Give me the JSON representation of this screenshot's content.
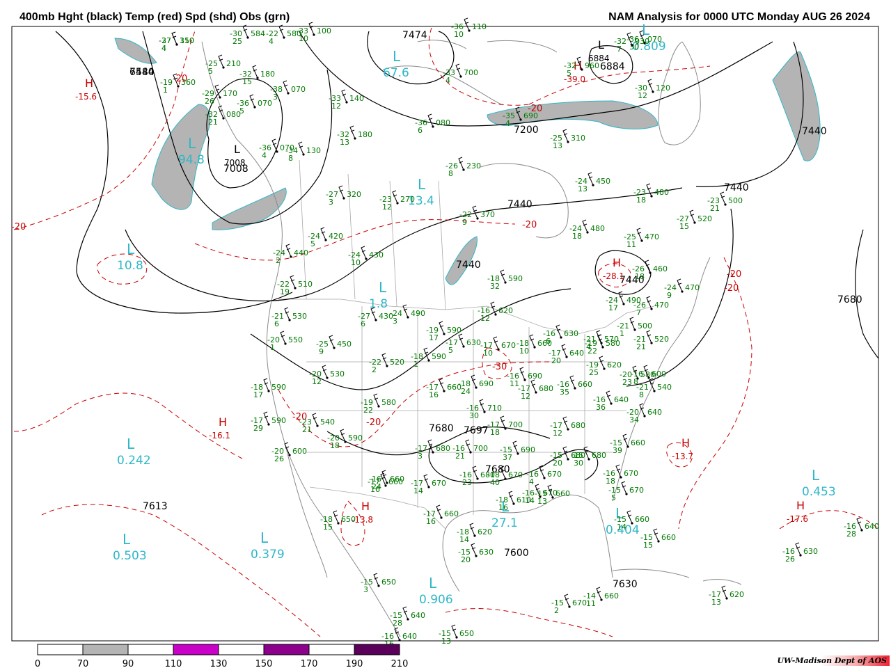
{
  "header": {
    "left": "400mb Hght (black) Temp (red) Spd (shd) Obs (grn)",
    "right": "NAM Analysis for 0000 UTC Monday  AUG 26 2024"
  },
  "legend": {
    "ticks": [
      "0",
      "70",
      "90",
      "110",
      "130",
      "150",
      "170",
      "190",
      "210"
    ],
    "colors": [
      "#ffffff",
      "#b4b4b4",
      "#ffffff",
      "#c800c8",
      "#ffffff",
      "#8c008c",
      "#ffffff",
      "#5a005a"
    ]
  },
  "credit": "UW-Madison   Dept of AOS",
  "colors": {
    "height": "#000000",
    "temp": "#c80000",
    "speed": "#2fb7c8",
    "obs": "#007800",
    "shade": "#b4b4b4"
  },
  "height_labels": [
    "7440",
    "7008",
    "7200",
    "7440",
    "7440",
    "7440",
    "7680",
    "7440",
    "6884",
    "7440",
    "7613",
    "7600",
    "7680",
    "7697",
    "7680",
    "7630",
    "7474",
    "6584"
  ],
  "centers": [
    {
      "letter": "H",
      "val": "-15.6",
      "kind": "temp"
    },
    {
      "letter": "L",
      "val": "10.8",
      "kind": "speed"
    },
    {
      "letter": "L",
      "val": "94.8",
      "kind": "speed"
    },
    {
      "letter": "L",
      "val": "67.6",
      "kind": "speed"
    },
    {
      "letter": "L",
      "val": "0.809",
      "kind": "speed"
    },
    {
      "letter": "L",
      "val": "0.242",
      "kind": "speed"
    },
    {
      "letter": "L",
      "val": "0.503",
      "kind": "speed"
    },
    {
      "letter": "L",
      "val": "0.379",
      "kind": "speed"
    },
    {
      "letter": "L",
      "val": "0.906",
      "kind": "speed"
    },
    {
      "letter": "L",
      "val": "27.1",
      "kind": "speed"
    },
    {
      "letter": "L",
      "val": "0.404",
      "kind": "speed"
    },
    {
      "letter": "L",
      "val": "0.453",
      "kind": "speed"
    },
    {
      "letter": "L",
      "val": "13.4",
      "kind": "speed"
    },
    {
      "letter": "L",
      "val": "1.8",
      "kind": "speed"
    },
    {
      "letter": "H",
      "val": "-16.1",
      "kind": "temp"
    },
    {
      "letter": "H",
      "val": "-13.8",
      "kind": "temp"
    },
    {
      "letter": "H",
      "val": "-13.7",
      "kind": "temp"
    },
    {
      "letter": "H",
      "val": "-17.6",
      "kind": "temp"
    },
    {
      "letter": "H",
      "val": "-28.1",
      "kind": "temp"
    },
    {
      "letter": "H",
      "val": "-39.0",
      "kind": "temp"
    },
    {
      "letter": "L",
      "val": "7008",
      "kind": "height"
    },
    {
      "letter": "L",
      "val": "6884",
      "kind": "height"
    }
  ],
  "temp_labels": [
    "-20",
    "-20",
    "-20",
    "-20",
    "-20",
    "-20",
    "-20",
    "-20",
    "-30"
  ],
  "obs": [
    {
      "t": "-27",
      "h": "310",
      "s": "4"
    },
    {
      "t": "-25",
      "h": "210",
      "s": "5"
    },
    {
      "t": "-19",
      "h": "360",
      "s": "1"
    },
    {
      "t": "-30",
      "h": "584",
      "s": "25"
    },
    {
      "t": "-33",
      "h": "100",
      "s": "10"
    },
    {
      "t": "-36",
      "h": "070",
      "s": "5"
    },
    {
      "t": "-32",
      "h": "180",
      "s": "15"
    },
    {
      "t": "-38",
      "h": "070",
      "s": "3"
    },
    {
      "t": "-29",
      "h": "170",
      "s": "26"
    },
    {
      "t": "-32",
      "h": "080",
      "s": "21"
    },
    {
      "t": "-36",
      "h": "070",
      "s": "4"
    },
    {
      "t": "-34",
      "h": "130",
      "s": "8"
    },
    {
      "t": "-32",
      "h": "180",
      "s": "13"
    },
    {
      "t": "-27",
      "h": "320",
      "s": "3"
    },
    {
      "t": "-23",
      "h": "270",
      "s": "12"
    },
    {
      "t": "-26",
      "h": "230",
      "s": "8"
    },
    {
      "t": "-22",
      "h": "370",
      "s": "9"
    },
    {
      "t": "-24",
      "h": "420",
      "s": "5"
    },
    {
      "t": "-24",
      "h": "440",
      "s": "2"
    },
    {
      "t": "-24",
      "h": "430",
      "s": "10"
    },
    {
      "t": "-22",
      "h": "510",
      "s": "19"
    },
    {
      "t": "-21",
      "h": "530",
      "s": "6"
    },
    {
      "t": "-20",
      "h": "550",
      "s": "1"
    },
    {
      "t": "-27",
      "h": "430",
      "s": "6"
    },
    {
      "t": "-24",
      "h": "490",
      "s": "3"
    },
    {
      "t": "-25",
      "h": "450",
      "s": "9"
    },
    {
      "t": "-20",
      "h": "530",
      "s": "12"
    },
    {
      "t": "-22",
      "h": "520",
      "s": "2"
    },
    {
      "t": "-18",
      "h": "590",
      "s": "17"
    },
    {
      "t": "-19",
      "h": "580",
      "s": "22"
    },
    {
      "t": "-17",
      "h": "590",
      "s": "29"
    },
    {
      "t": "-23",
      "h": "540",
      "s": "21"
    },
    {
      "t": "-20",
      "h": "600",
      "s": "26"
    },
    {
      "t": "-20",
      "h": "590",
      "s": "18"
    },
    {
      "t": "-18",
      "h": "650",
      "s": "15"
    },
    {
      "t": "-17",
      "h": "660",
      "s": "16"
    },
    {
      "t": "-19",
      "h": "590",
      "s": "17"
    },
    {
      "t": "-17",
      "h": "630",
      "s": "5"
    },
    {
      "t": "-18",
      "h": "590",
      "s": "1"
    },
    {
      "t": "-17",
      "h": "660",
      "s": "16"
    },
    {
      "t": "-18",
      "h": "690",
      "s": "24"
    },
    {
      "t": "-16",
      "h": "710",
      "s": "30"
    },
    {
      "t": "-17",
      "h": "700",
      "s": "18"
    },
    {
      "t": "-16",
      "h": "620",
      "s": "12"
    },
    {
      "t": "-18",
      "h": "590",
      "s": "32"
    },
    {
      "t": "-17",
      "h": "670",
      "s": "10"
    },
    {
      "t": "-18",
      "h": "660",
      "s": "10"
    },
    {
      "t": "-16",
      "h": "630",
      "s": "6"
    },
    {
      "t": "-17",
      "h": "640",
      "s": "20"
    },
    {
      "t": "-16",
      "h": "690",
      "s": "11"
    },
    {
      "t": "-17",
      "h": "680",
      "s": "12"
    },
    {
      "t": "-16",
      "h": "660",
      "s": "35"
    },
    {
      "t": "-17",
      "h": "680",
      "s": "12"
    },
    {
      "t": "-19",
      "h": "620",
      "s": "25"
    },
    {
      "t": "-19",
      "h": "580",
      "s": "22"
    },
    {
      "t": "-16",
      "h": "640",
      "s": "36"
    },
    {
      "t": "-20",
      "h": "640",
      "s": "34"
    },
    {
      "t": "-15",
      "h": "660",
      "s": "39"
    },
    {
      "t": "-15",
      "h": "690",
      "s": "37"
    },
    {
      "t": "-15",
      "h": "680",
      "s": "20"
    },
    {
      "t": "-15",
      "h": "680",
      "s": "30"
    },
    {
      "t": "-16",
      "h": "670",
      "s": "18"
    },
    {
      "t": "-16",
      "h": "670",
      "s": "4"
    },
    {
      "t": "-16",
      "h": "670",
      "s": "14"
    },
    {
      "t": "-15",
      "h": "670",
      "s": "5"
    },
    {
      "t": "-15",
      "h": "660",
      "s": "14"
    },
    {
      "t": "-15",
      "h": "660",
      "s": "15"
    },
    {
      "t": "-18",
      "h": "610",
      "s": "16"
    },
    {
      "t": "-15",
      "h": "660",
      "s": "13"
    },
    {
      "t": "-16",
      "h": "700",
      "s": "21"
    },
    {
      "t": "-16",
      "h": "680",
      "s": "23"
    },
    {
      "t": "-18",
      "h": "670",
      "s": "40"
    },
    {
      "t": "-17",
      "h": "680",
      "s": "3"
    },
    {
      "t": "-17",
      "h": "670",
      "s": "14"
    },
    {
      "t": "-16",
      "h": "660",
      "s": "24"
    },
    {
      "t": "-17",
      "h": "660",
      "s": "16"
    },
    {
      "t": "-18",
      "h": "620",
      "s": "14"
    },
    {
      "t": "-15",
      "h": "630",
      "s": "20"
    },
    {
      "t": "-15",
      "h": "650",
      "s": "3"
    },
    {
      "t": "-15",
      "h": "640",
      "s": "28"
    },
    {
      "t": "-16",
      "h": "640",
      "s": "16"
    },
    {
      "t": "-15",
      "h": "650",
      "s": "13"
    },
    {
      "t": "-15",
      "h": "670",
      "s": "2"
    },
    {
      "t": "-14",
      "h": "660",
      "s": "11"
    },
    {
      "t": "-17",
      "h": "620",
      "s": "13"
    },
    {
      "t": "-16",
      "h": "630",
      "s": "26"
    },
    {
      "t": "-16",
      "h": "640",
      "s": "28"
    },
    {
      "t": "-30",
      "h": "120",
      "s": "12"
    },
    {
      "t": "-36",
      "h": "080",
      "s": "6"
    },
    {
      "t": "-36",
      "h": "070",
      "s": "30"
    },
    {
      "t": "-32",
      "h": "030",
      "s": "7"
    },
    {
      "t": "-32",
      "h": "960",
      "s": "5"
    },
    {
      "t": "-25",
      "h": "310",
      "s": "13"
    },
    {
      "t": "-24",
      "h": "450",
      "s": "13"
    },
    {
      "t": "-24",
      "h": "480",
      "s": "18"
    },
    {
      "t": "-23",
      "h": "480",
      "s": "18"
    },
    {
      "t": "-23",
      "h": "500",
      "s": "21"
    },
    {
      "t": "-27",
      "h": "520",
      "s": "15"
    },
    {
      "t": "-25",
      "h": "470",
      "s": "11"
    },
    {
      "t": "-26",
      "h": "460",
      "s": "18"
    },
    {
      "t": "-24",
      "h": "470",
      "s": "9"
    },
    {
      "t": "-26",
      "h": "470",
      "s": "7"
    },
    {
      "t": "-24",
      "h": "490",
      "s": "17"
    },
    {
      "t": "-21",
      "h": "500",
      "s": "1"
    },
    {
      "t": "-21",
      "h": "520",
      "s": "21"
    },
    {
      "t": "-21",
      "h": "570",
      "s": "4"
    },
    {
      "t": "-20",
      "h": "580",
      "s": "23"
    },
    {
      "t": "-16",
      "h": "600",
      "s": "8"
    },
    {
      "t": "-21",
      "h": "540",
      "s": "8"
    },
    {
      "t": "-22",
      "h": "580",
      "s": "4"
    },
    {
      "t": "-33",
      "h": "140",
      "s": "12"
    },
    {
      "t": "-36",
      "h": "110",
      "s": "10"
    },
    {
      "t": "-33",
      "h": "700",
      "s": "4"
    },
    {
      "t": "-35",
      "h": "690",
      "s": "4"
    },
    {
      "t": "-37",
      "h": "150",
      "s": "4"
    }
  ]
}
